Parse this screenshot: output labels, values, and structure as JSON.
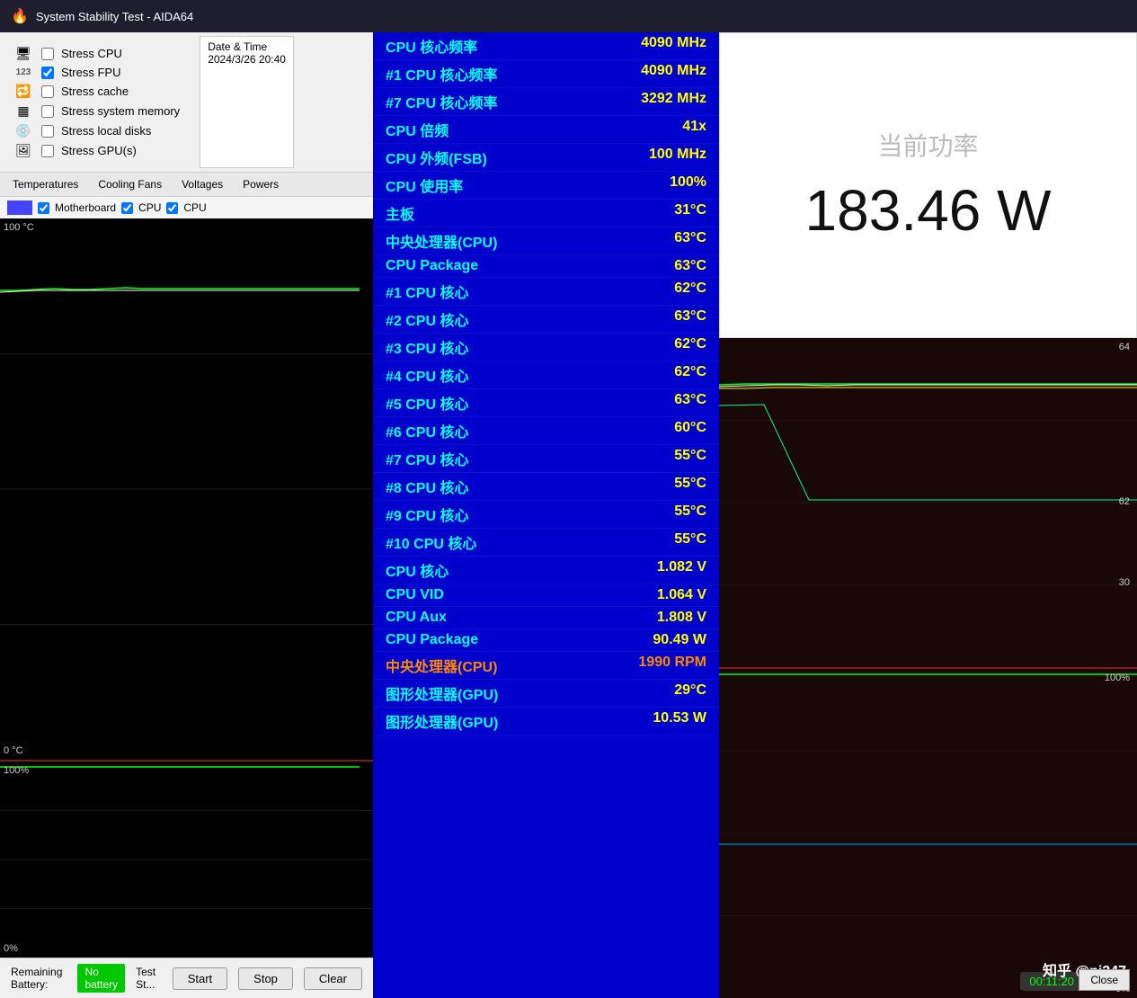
{
  "titlebar": {
    "icon": "🔥",
    "title": "System Stability Test - AIDA64"
  },
  "stress_options": {
    "items": [
      {
        "id": "stress-cpu",
        "label": "Stress CPU",
        "checked": false,
        "icon": "🖥"
      },
      {
        "id": "stress-fpu",
        "label": "Stress FPU",
        "checked": true,
        "icon": "123"
      },
      {
        "id": "stress-cache",
        "label": "Stress cache",
        "checked": false,
        "icon": "💾"
      },
      {
        "id": "stress-memory",
        "label": "Stress system memory",
        "checked": false,
        "icon": "🔲"
      },
      {
        "id": "stress-disks",
        "label": "Stress local disks",
        "checked": false,
        "icon": "💿"
      },
      {
        "id": "stress-gpu",
        "label": "Stress GPU(s)",
        "checked": false,
        "icon": "🖼"
      }
    ],
    "datetime_label": "Date & Time",
    "datetime_value": "2024/3/26 20:40"
  },
  "tabs": [
    "Temperatures",
    "Cooling Fans",
    "Voltages",
    "Powers"
  ],
  "chart_checkboxes": [
    "Motherboard",
    "CPU",
    "CPU"
  ],
  "chart": {
    "y_max": "100 °C",
    "y_min": "0 °C"
  },
  "center_data": [
    {
      "label": "CPU 核心频率",
      "value": "4090 MHz"
    },
    {
      "label": "#1 CPU 核心频率",
      "value": "4090 MHz"
    },
    {
      "label": "#7 CPU 核心频率",
      "value": "3292 MHz"
    },
    {
      "label": "CPU 倍频",
      "value": "41x"
    },
    {
      "label": "CPU 外频(FSB)",
      "value": "100 MHz"
    },
    {
      "label": "CPU 使用率",
      "value": "100%"
    },
    {
      "label": "主板",
      "value": "31°C"
    },
    {
      "label": "中央处理器(CPU)",
      "value": "63°C"
    },
    {
      "label": "CPU Package",
      "value": "63°C"
    },
    {
      "label": "#1 CPU 核心",
      "value": "62°C"
    },
    {
      "label": "#2 CPU 核心",
      "value": "63°C"
    },
    {
      "label": "#3 CPU 核心",
      "value": "62°C"
    },
    {
      "label": "#4 CPU 核心",
      "value": "62°C"
    },
    {
      "label": "#5 CPU 核心",
      "value": "63°C"
    },
    {
      "label": "#6 CPU 核心",
      "value": "60°C"
    },
    {
      "label": "#7 CPU 核心",
      "value": "55°C"
    },
    {
      "label": "#8 CPU 核心",
      "value": "55°C"
    },
    {
      "label": "#9 CPU 核心",
      "value": "55°C"
    },
    {
      "label": "#10 CPU 核心",
      "value": "55°C"
    },
    {
      "label": "CPU 核心",
      "value": "1.082 V"
    },
    {
      "label": "CPU VID",
      "value": "1.064 V"
    },
    {
      "label": "CPU Aux",
      "value": "1.808 V"
    },
    {
      "label": "CPU Package",
      "value": "90.49 W"
    },
    {
      "label": "中央处理器(CPU)",
      "value": "1990 RPM",
      "orange": true
    },
    {
      "label": "图形处理器(GPU)",
      "value": "29°C"
    },
    {
      "label": "图形处理器(GPU)",
      "value": "10.53 W"
    }
  ],
  "power_display": {
    "label": "当前功率",
    "value": "183.46 W"
  },
  "right_chart": {
    "top_max": "62",
    "top_mid": "30",
    "bot_max": "100%",
    "bot_min": "0%"
  },
  "footer": {
    "battery_label": "Remaining Battery:",
    "battery_value": "No battery",
    "test_status": "Test St...",
    "buttons": [
      "Start",
      "Stop",
      "Clear"
    ]
  },
  "timer": "00:11:20",
  "watermark": "知乎 @pj247",
  "close_label": "Close"
}
